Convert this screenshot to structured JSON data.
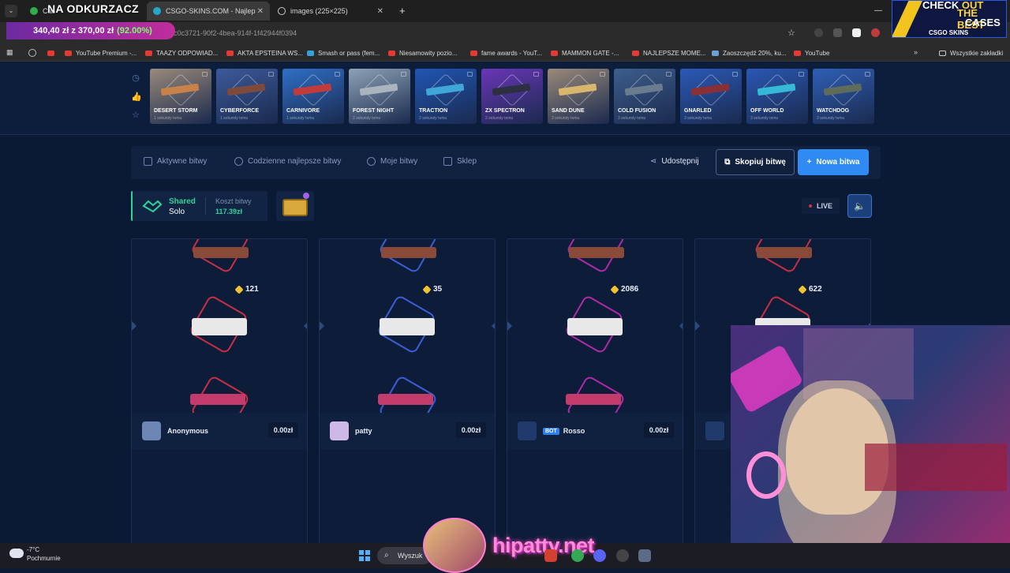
{
  "browser": {
    "tabs": [
      {
        "label": "Cas",
        "active": false
      },
      {
        "label": "CSGO-SKINS.COM - Najlep",
        "active": true
      },
      {
        "label": "images (225×225)",
        "active": false
      }
    ],
    "url": "c0c3721-90f2-4bea-914f-1f42944f0394",
    "bookmarks": [
      "YouTube Premium -...",
      "TAAZY ODPOWIAD...",
      "AKTA EPSTEINA WS...",
      "Smash or pass (fem...",
      "Niesamowity pozio...",
      "fame awards - YouT...",
      "MAMMON GATE -...",
      "NAJLEPSZE MOME...",
      "Zaoszczędź 20%, ku...",
      "YouTube"
    ],
    "all_bookmarks": "Wszystkie zakładki"
  },
  "overlay": {
    "title": "NA ODKURZACZ",
    "price": "340,40 zł z 370,00 zł",
    "percent": "(92.00%)",
    "promo": {
      "line1a": "CHECK",
      "line1b": "OUT",
      "line2": "THE BEST",
      "line3": "CASES",
      "logo": "CSGO SKINS"
    }
  },
  "drops": [
    {
      "name": "DESERT STORM",
      "time": "1 sekundy temu",
      "bg": "#9a8a7a",
      "gun": "#c9814a"
    },
    {
      "name": "CYBERFORCE",
      "time": "1 sekundy temu",
      "bg": "#3c5a9a",
      "gun": "#7e4b3a"
    },
    {
      "name": "CARNIVORE",
      "time": "1 sekundy temu",
      "bg": "#2f6fc6",
      "gun": "#c23b3b"
    },
    {
      "name": "FOREST NIGHT",
      "time": "2 sekundy temu",
      "bg": "#8da3b7",
      "gun": "#a9b4bf"
    },
    {
      "name": "TRACTION",
      "time": "2 sekundy temu",
      "bg": "#2056b4",
      "gun": "#3fa6d8"
    },
    {
      "name": "ZX SPECTRON",
      "time": "2 sekundy temu",
      "bg": "#6a36b8",
      "gun": "#2c3040"
    },
    {
      "name": "SAND DUNE",
      "time": "3 sekundy temu",
      "bg": "#9a8a7a",
      "gun": "#d9b66e"
    },
    {
      "name": "COLD FUSION",
      "time": "3 sekundy temu",
      "bg": "#3d5e8c",
      "gun": "#6a7d8f"
    },
    {
      "name": "GNARLED",
      "time": "3 sekundy temu",
      "bg": "#2b5ab8",
      "gun": "#8a2f34"
    },
    {
      "name": "OFF WORLD",
      "time": "3 sekundy temu",
      "bg": "#2a58b4",
      "gun": "#35b9d6"
    },
    {
      "name": "WATCHDOG",
      "time": "3 sekundy temu",
      "bg": "#2f5fb6",
      "gun": "#5f6c5a"
    }
  ],
  "nav": {
    "items": [
      "Aktywne bitwy",
      "Codzienne najlepsze bitwy",
      "Moje bitwy",
      "Sklep"
    ],
    "share": "Udostępnij",
    "copy": "Skopiuj bitwę",
    "new": "Nowa bitwa"
  },
  "battle": {
    "mode_label": "Shared",
    "mode_value": "Solo",
    "cost_label": "Koszt bitwy",
    "cost_value": "117.39zł",
    "live": "LIVE"
  },
  "players": [
    {
      "name": "Anonymous",
      "value": "121",
      "amount": "0.00zł",
      "bot": "",
      "hex": "#c62f45",
      "avatar": "#6d86b4"
    },
    {
      "name": "patty",
      "value": "35",
      "amount": "0.00zł",
      "bot": "",
      "hex": "#3b5ed6",
      "avatar": "#cdb8e8"
    },
    {
      "name": "Rosso",
      "value": "2086",
      "amount": "0.00zł",
      "bot": "BOT",
      "hex": "#b02aa6",
      "avatar": "#1f3a6b"
    },
    {
      "name": "",
      "value": "622",
      "amount": "",
      "bot": "",
      "hex": "#c62f45",
      "avatar": "#1f3a6b"
    }
  ],
  "taskbar": {
    "temp": "-7°C",
    "weather": "Pochmurnie",
    "search": "Wyszuk",
    "brand": "hipatty.net"
  }
}
